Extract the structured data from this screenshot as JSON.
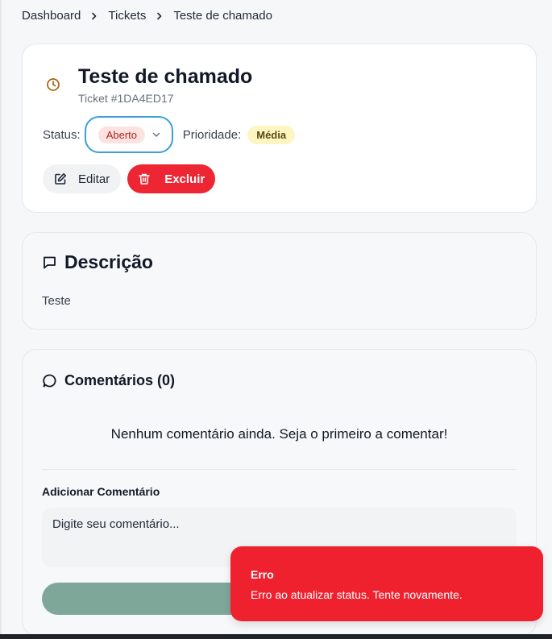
{
  "breadcrumb": {
    "items": [
      "Dashboard",
      "Tickets",
      "Teste de chamado"
    ]
  },
  "ticket": {
    "title": "Teste de chamado",
    "id_text": "Ticket #1DA4ED17",
    "status_label": "Status:",
    "status_value": "Aberto",
    "priority_label": "Prioridade:",
    "priority_value": "Média",
    "edit_label": "Editar",
    "delete_label": "Excluir"
  },
  "description": {
    "title": "Descrição",
    "text": "Teste"
  },
  "comments": {
    "title": "Comentários (0)",
    "empty_message": "Nenhum comentário ainda. Seja o primeiro a comentar!",
    "add_label": "Adicionar Comentário",
    "placeholder": "Digite seu comentário..."
  },
  "toast": {
    "title": "Erro",
    "message": "Erro ao atualizar status. Tente novamente."
  },
  "colors": {
    "accent_focus": "#3b9fd8",
    "danger": "#ee2533",
    "status_open_bg": "#fde2e2",
    "priority_medium_bg": "#fdf6c3",
    "send_button": "#7ea699",
    "clock_icon": "#a5620f"
  },
  "icons": [
    "chevron-right-icon",
    "clock-icon",
    "chevron-down-icon",
    "edit-icon",
    "trash-icon",
    "message-square-icon",
    "message-circle-icon",
    "send-icon"
  ]
}
